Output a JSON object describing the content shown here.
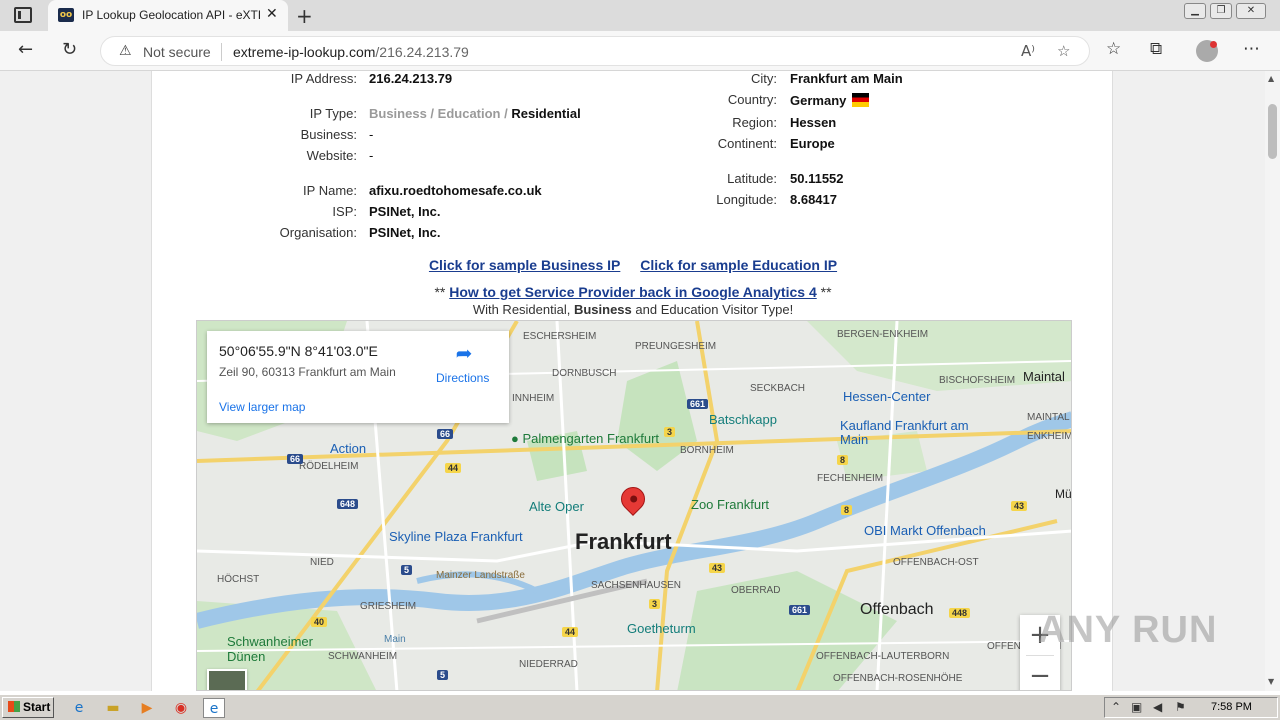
{
  "browser": {
    "tab_title": "IP Lookup Geolocation API - eXTREME IP LOOKUP",
    "tab_favicon_text": "oo",
    "not_secure_label": "Not secure",
    "url_domain": "extreme-ip-lookup.com",
    "url_path": "/216.24.213.79"
  },
  "details_left": {
    "ip_address": {
      "label": "IP Address:",
      "value": "216.24.213.79"
    },
    "ip_type": {
      "label": "IP Type:",
      "business": "Business",
      "sep": " / ",
      "education": "Education",
      "residential": "Residential"
    },
    "business": {
      "label": "Business:",
      "value": "-"
    },
    "website": {
      "label": "Website:",
      "value": "-"
    },
    "ip_name": {
      "label": "IP Name:",
      "value": "afixu.roedtohomesafe.co.uk"
    },
    "isp": {
      "label": "ISP:",
      "value": "PSINet, Inc."
    },
    "organisation": {
      "label": "Organisation:",
      "value": "PSINet, Inc."
    }
  },
  "details_right": {
    "city": {
      "label": "City:",
      "value": "Frankfurt am Main"
    },
    "country": {
      "label": "Country:",
      "value": "Germany"
    },
    "region": {
      "label": "Region:",
      "value": "Hessen"
    },
    "continent": {
      "label": "Continent:",
      "value": "Europe"
    },
    "latitude": {
      "label": "Latitude:",
      "value": "50.11552"
    },
    "longitude": {
      "label": "Longitude:",
      "value": "8.68417"
    }
  },
  "links": {
    "sample_business": "Click for sample Business IP",
    "sample_education": "Click for sample Education IP",
    "ga_prefix": "** ",
    "ga_link": "How to get Service Provider back in Google Analytics 4",
    "ga_suffix": " **",
    "sub_prefix": "With Residential, ",
    "sub_bold": "Business",
    "sub_suffix": " and Education Visitor Type!"
  },
  "map": {
    "coords": "50°06'55.9\"N 8°41'03.0\"E",
    "address": "Zeil 90, 60313 Frankfurt am Main",
    "directions": "Directions",
    "view_larger": "View larger map",
    "city_main": "Frankfurt",
    "city_offenbach": "Offenbach",
    "labels": {
      "eschersheim": "ESCHERSHEIM",
      "preungesheim": "PREUNGESHEIM",
      "bergen": "BERGEN-ENKHEIM",
      "dornbusch": "DORNBUSCH",
      "seckbach": "SECKBACH",
      "bischofsheim": "BISCHOFSHEIM",
      "maintal": "Maintal",
      "ginnheim": "INNHEIM",
      "bornheim": "BORNHEIM",
      "rodelheim": "RÖDELHEIM",
      "fechenheim": "FECHENHEIM",
      "nied": "NIED",
      "sachsenhausen": "SACHSENHAUSEN",
      "oberrad": "OBERRAD",
      "offenbach_ost": "OFFENBACH-OST",
      "hochst": "HÖCHST",
      "griesheim": "GRIESHEIM",
      "schwanheim": "SCHWANHEIM",
      "niederrad": "NIEDERRAD",
      "lauterborn": "OFFENBACH-LAUTERBORN",
      "rosenhohe": "OFFENBACH-ROSENHÖHE",
      "bieber": "OFFENBACH-BI",
      "mainzer": "Mainzer Landstraße",
      "main_river": "Main",
      "maintal_right": "MAINTAL",
      "enkheim": "ENKHEIM",
      "mu": "Mü"
    },
    "pois": {
      "palmengarten": "Palmengarten Frankfurt",
      "batschkapp": "Batschkapp",
      "hessen_center": "Hessen-Center",
      "kaufland": "Kaufland Frankfurt am Main",
      "action": "Action",
      "alte_oper": "Alte Oper",
      "zoo": "Zoo Frankfurt",
      "skyline": "Skyline Plaza Frankfurt",
      "obi": "OBI Markt Offenbach",
      "goetheturm": "Goetheturm",
      "schwanheimer": "Schwanheimer Dünen"
    },
    "shields": {
      "a661": "661",
      "a66": "66",
      "a66b": "66",
      "r3": "3",
      "r3b": "3",
      "r44": "44",
      "r44b": "44",
      "a648": "648",
      "r8": "8",
      "r8b": "8",
      "r5": "5",
      "r5b": "5",
      "r43": "43",
      "r43b": "43",
      "a661b": "661",
      "r448": "448",
      "r40": "40"
    },
    "zoom_in": "+",
    "zoom_out": "−"
  },
  "watermark": "ANY RUN",
  "taskbar": {
    "start": "Start",
    "clock": "7:58 PM"
  }
}
